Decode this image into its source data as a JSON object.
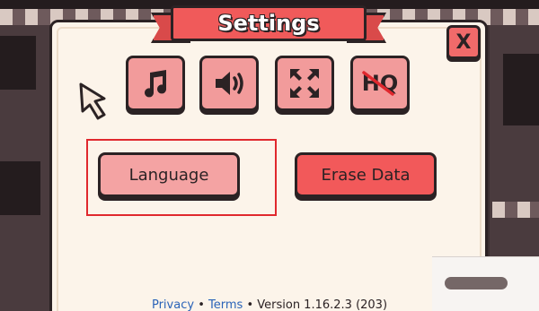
{
  "title": "Settings",
  "close_label": "X",
  "icon_buttons": [
    {
      "name": "music",
      "icon": "music-note-icon"
    },
    {
      "name": "sound",
      "icon": "speaker-icon"
    },
    {
      "name": "fullscreen",
      "icon": "fullscreen-arrows-icon"
    },
    {
      "name": "hq",
      "icon": "hq-crossed-icon",
      "label": "HQ"
    }
  ],
  "buttons": {
    "language": "Language",
    "erase": "Erase Data"
  },
  "footer": {
    "privacy": "Privacy",
    "separator": "•",
    "terms": "Terms",
    "version": "Version 1.16.2.3 (203)"
  },
  "colors": {
    "ribbon": "#f05a5a",
    "icon_button": "#f29b9b",
    "language_button": "#f4a3a3",
    "erase_button": "#f2595a",
    "panel": "#fcf4ea",
    "highlight": "#e0282e",
    "link": "#2a63b8"
  }
}
